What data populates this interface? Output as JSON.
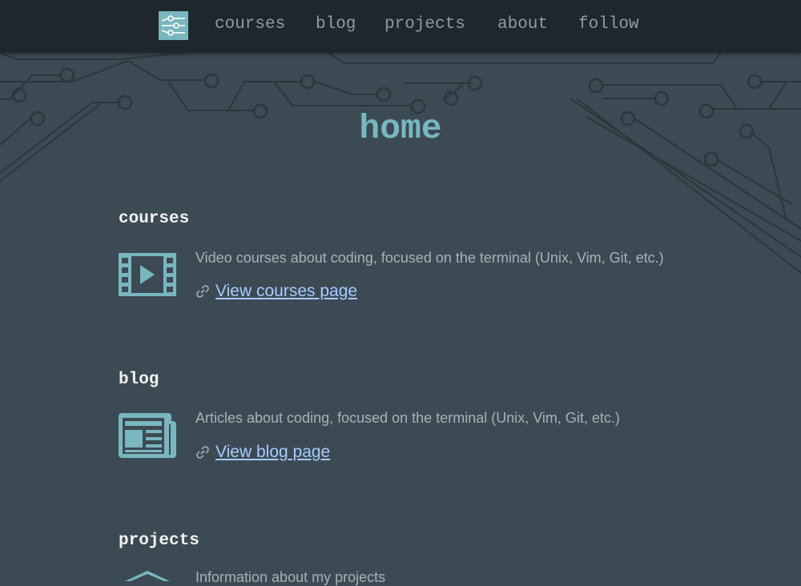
{
  "header": {
    "logo_icon": "circuit-logo-icon",
    "nav": [
      "courses",
      "blog",
      "projects",
      "about",
      "follow"
    ]
  },
  "main": {
    "title": "home",
    "sections": [
      {
        "title": "courses",
        "icon": "film-strip-icon",
        "description": "Video courses about coding, focused on the terminal (Unix, Vim, Git, etc.)",
        "link_icon": "link-icon",
        "link_label": "View courses page"
      },
      {
        "title": "blog",
        "icon": "newspaper-icon",
        "description": "Articles about coding, focused on the terminal (Unix, Vim, Git, etc.)",
        "link_icon": "link-icon",
        "link_label": "View blog page"
      },
      {
        "title": "projects",
        "icon": "house-icon",
        "description": "Information about my projects"
      }
    ]
  },
  "colors": {
    "page_background": "#3c4a54",
    "header_background": "#1f272d",
    "accent": "#79b6be",
    "link": "#a8cbff",
    "nav_text": "#8f9aa1",
    "body_text": "#a7b2b8",
    "heading_text": "#f2f2f2"
  }
}
